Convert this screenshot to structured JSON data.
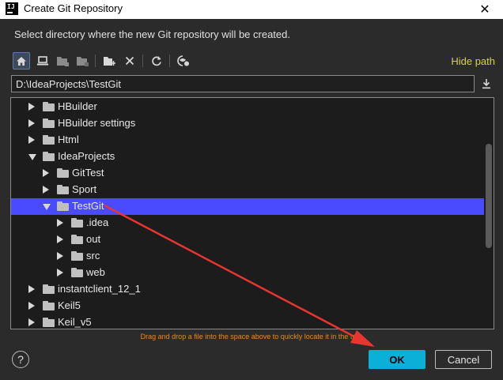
{
  "window": {
    "app_icon_text": "IJ",
    "title": "Create Git Repository",
    "close_glyph": "✕"
  },
  "instruction": "Select directory where the new Git repository will be created.",
  "toolbar": {
    "buttons": [
      "home-icon",
      "desktop-icon",
      "project-folder-icon",
      "module-folder-icon",
      "new-folder-icon",
      "delete-icon",
      "refresh-icon",
      "show-hidden-icon"
    ],
    "hide_path_label": "Hide path"
  },
  "path": {
    "value": "D:\\IdeaProjects\\TestGit"
  },
  "tree": {
    "rows": [
      {
        "label": "HBuilder",
        "depth": 0,
        "state": "collapsed",
        "selected": false
      },
      {
        "label": "HBuilder settings",
        "depth": 0,
        "state": "collapsed",
        "selected": false
      },
      {
        "label": "Html",
        "depth": 0,
        "state": "collapsed",
        "selected": false
      },
      {
        "label": "IdeaProjects",
        "depth": 0,
        "state": "expanded",
        "selected": false
      },
      {
        "label": "GitTest",
        "depth": 1,
        "state": "collapsed",
        "selected": false
      },
      {
        "label": "Sport",
        "depth": 1,
        "state": "collapsed",
        "selected": false
      },
      {
        "label": "TestGit",
        "depth": 1,
        "state": "expanded",
        "selected": true
      },
      {
        "label": ".idea",
        "depth": 2,
        "state": "collapsed",
        "selected": false
      },
      {
        "label": "out",
        "depth": 2,
        "state": "collapsed",
        "selected": false
      },
      {
        "label": "src",
        "depth": 2,
        "state": "collapsed",
        "selected": false
      },
      {
        "label": "web",
        "depth": 2,
        "state": "collapsed",
        "selected": false
      },
      {
        "label": "instantclient_12_1",
        "depth": 0,
        "state": "collapsed",
        "selected": false
      },
      {
        "label": "Keil5",
        "depth": 0,
        "state": "collapsed",
        "selected": false
      },
      {
        "label": "Keil_v5",
        "depth": 0,
        "state": "collapsed",
        "selected": false
      }
    ]
  },
  "hint": "Drag and drop a file into the space above to quickly locate it in the tree",
  "buttons": {
    "help": "?",
    "ok": "OK",
    "cancel": "Cancel"
  },
  "colors": {
    "selection": "#4a4aff",
    "ok_button": "#0bb0d8",
    "hint_text": "#e08a2c",
    "hide_path": "#d7d72f",
    "annotation_arrow": "#e8352f"
  }
}
